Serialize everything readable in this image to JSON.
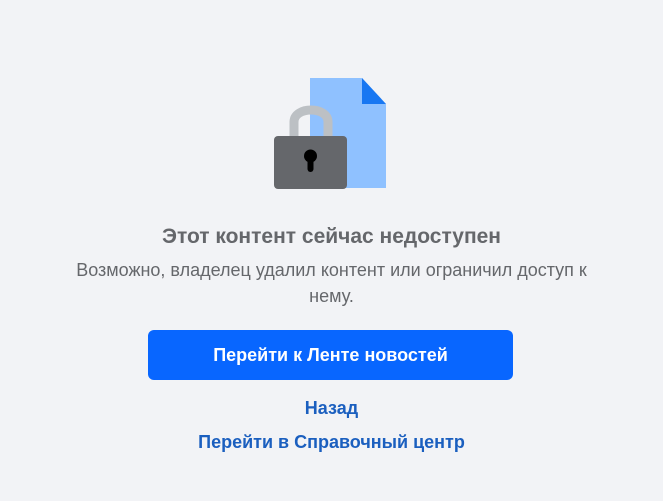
{
  "illustration": {
    "icon": "locked-document-icon",
    "colors": {
      "document": "#8fc1ff",
      "document_fold": "#1877f2",
      "padlock_body": "#65676b",
      "padlock_shackle": "#bcc0c4",
      "keyhole": "#000000"
    }
  },
  "message": {
    "title": "Этот контент сейчас недоступен",
    "subtitle": "Возможно, владелец удалил контент или ограничил доступ к нему."
  },
  "actions": {
    "primary_label": "Перейти к Ленте новостей",
    "back_label": "Назад",
    "help_label": "Перейти в Справочный центр"
  },
  "colors": {
    "background": "#f2f3f6",
    "primary_button": "#0866ff",
    "link": "#1b5fbf",
    "text_secondary": "#65676b"
  }
}
